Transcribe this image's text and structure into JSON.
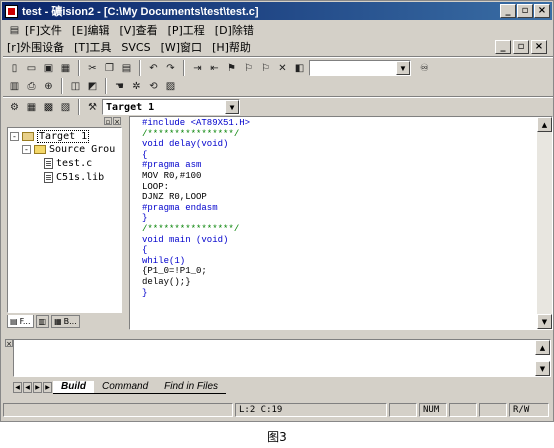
{
  "window": {
    "title": "test  - 礦ision2 - [C:\\My Documents\\test\\test.c]",
    "btn_min": "_",
    "btn_max": "▫",
    "btn_close": "×"
  },
  "menu1": [
    "[F]文件",
    "[E]编辑",
    "[V]查看",
    "[P]工程",
    "[D]除错"
  ],
  "menu2": [
    "[r]外围设备",
    "[T]工具",
    "SVCS",
    "[W]窗口",
    "[H]帮助"
  ],
  "toolbar": {
    "target_select": "Target 1",
    "find_value": ""
  },
  "project": {
    "tree": [
      {
        "label": "Target 1",
        "level": 0,
        "type": "target",
        "expander": "-"
      },
      {
        "label": "Source Grou",
        "level": 1,
        "type": "folder",
        "expander": "-"
      },
      {
        "label": "test.c",
        "level": 2,
        "type": "file",
        "expander": ""
      },
      {
        "label": "C51s.lib",
        "level": 2,
        "type": "file",
        "expander": ""
      }
    ],
    "tabs": [
      "F...",
      "",
      "B..."
    ]
  },
  "editor": {
    "lines": [
      {
        "t": "#include <AT89X51.H>",
        "c": "kw"
      },
      {
        "t": "/****************/",
        "c": "cm"
      },
      {
        "t": "void delay(void)",
        "c": "kw"
      },
      {
        "t": "{",
        "c": "kw"
      },
      {
        "t": "#pragma asm",
        "c": "kw"
      },
      {
        "t": "MOV R0,#100",
        "c": "tx"
      },
      {
        "t": "LOOP:",
        "c": "tx"
      },
      {
        "t": "DJNZ R0,LOOP",
        "c": "tx"
      },
      {
        "t": "#pragma endasm",
        "c": "kw"
      },
      {
        "t": "}",
        "c": "kw"
      },
      {
        "t": "/****************/",
        "c": "cm"
      },
      {
        "t": "void main (void)",
        "c": "kw"
      },
      {
        "t": "{",
        "c": "kw"
      },
      {
        "t": "while(1)",
        "c": "kw"
      },
      {
        "t": "{P1_0=!P1_0;",
        "c": "tx"
      },
      {
        "t": "delay();}",
        "c": "tx"
      },
      {
        "t": "}",
        "c": "kw"
      }
    ]
  },
  "output": {
    "tabs": [
      "Build",
      "Command",
      "Find in Files"
    ]
  },
  "status": {
    "position": "L:2 C:19",
    "mode": "NUM",
    "rw": "R/W"
  },
  "caption": "图3"
}
